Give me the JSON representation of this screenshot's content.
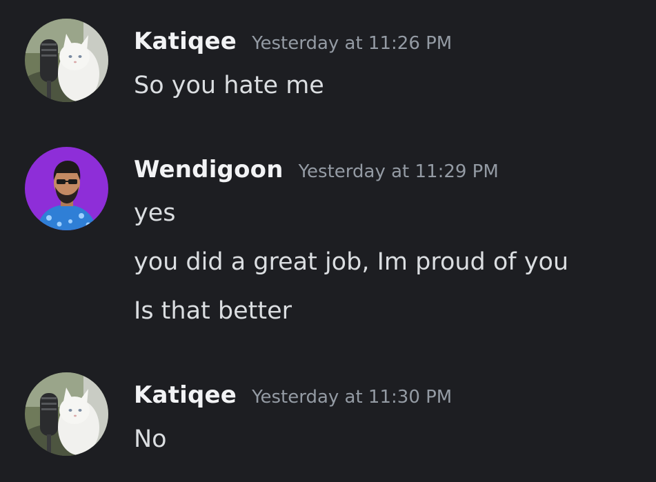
{
  "messages": [
    {
      "author": "Katiqee",
      "timestamp": "Yesterday at 11:26 PM",
      "avatar_icon": "cat-with-microphone-avatar",
      "lines": [
        "So you hate me"
      ]
    },
    {
      "author": "Wendigoon",
      "timestamp": "Yesterday at 11:29 PM",
      "avatar_icon": "man-with-sunglasses-avatar",
      "lines": [
        "yes",
        "you did a great job, Im proud of you",
        "Is that better"
      ]
    },
    {
      "author": "Katiqee",
      "timestamp": "Yesterday at 11:30 PM",
      "avatar_icon": "cat-with-microphone-avatar",
      "lines": [
        "No"
      ]
    }
  ],
  "colors": {
    "background": "#1d1e22",
    "username": "#f2f3f5",
    "timestamp": "#949ba4",
    "message_text": "#dbdee1",
    "wendigoon_avatar_bg": "#8e2ed8"
  }
}
